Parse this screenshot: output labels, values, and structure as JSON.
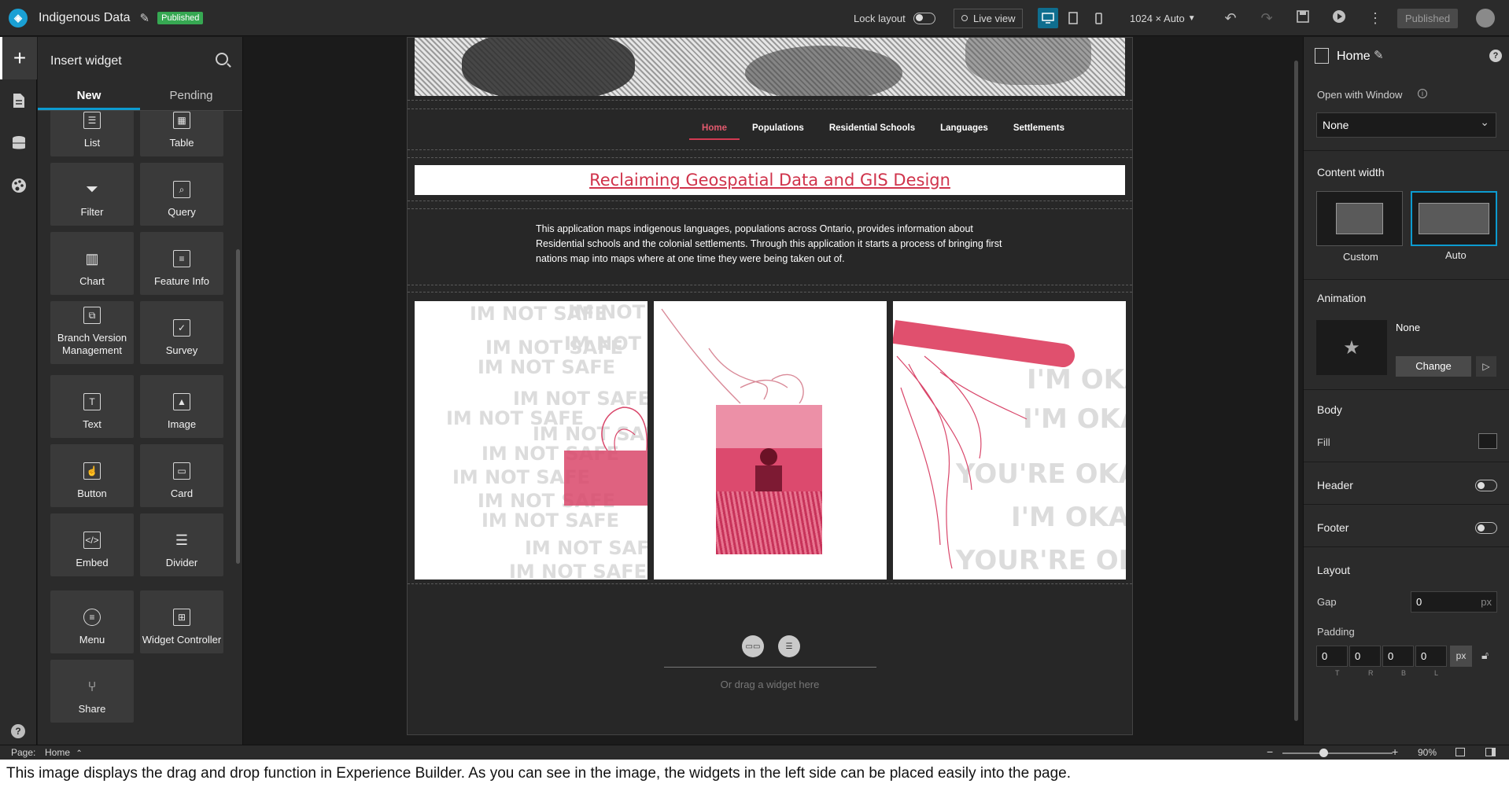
{
  "topbar": {
    "app_title": "Indigenous Data",
    "status_badge": "Published",
    "lock_layout_label": "Lock layout",
    "live_view_label": "Live view",
    "screen_size": "1024 × Auto",
    "publish_button": "Published"
  },
  "widget_panel": {
    "title": "Insert widget",
    "tabs": [
      "New",
      "Pending"
    ],
    "widgets": {
      "list": "List",
      "table": "Table",
      "filter": "Filter",
      "query": "Query",
      "chart": "Chart",
      "feature_info": "Feature Info",
      "branch_version": "Branch Version Management",
      "survey": "Survey",
      "text": "Text",
      "image": "Image",
      "button": "Button",
      "card": "Card",
      "embed": "Embed",
      "divider": "Divider",
      "menu": "Menu",
      "widget_controller": "Widget Controller",
      "share": "Share"
    }
  },
  "page": {
    "nav": [
      "Home",
      "Populations",
      "Residential Schools",
      "Languages",
      "Settlements"
    ],
    "title": "Reclaiming Geospatial Data and GIS Design",
    "description": "This application maps indigenous languages, populations across Ontario, provides information about Residential schools and the colonial settlements. Through this application it starts a process of bringing first nations map into maps where at one time they were being taken out of.",
    "card1_watermark": "IM NOT SAFE",
    "card3_watermark": [
      "I'M OKAY",
      "YOU'RE OKAY",
      "I'M OKAY",
      "YOUR'RE OKAY"
    ],
    "drop_hint": "Or drag a widget here"
  },
  "right_panel": {
    "page_name": "Home",
    "open_with_window_label": "Open with Window",
    "open_with_window_value": "None",
    "content_width_label": "Content width",
    "content_width_options": [
      "Custom",
      "Auto"
    ],
    "animation_label": "Animation",
    "animation_value": "None",
    "change_button": "Change",
    "body_label": "Body",
    "fill_label": "Fill",
    "header_label": "Header",
    "footer_label": "Footer",
    "layout_label": "Layout",
    "gap_label": "Gap",
    "gap_value": "0",
    "gap_unit": "px",
    "padding_label": "Padding",
    "padding_values": [
      "0",
      "0",
      "0",
      "0"
    ],
    "padding_sides": [
      "T",
      "R",
      "B",
      "L"
    ],
    "padding_unit": "px"
  },
  "statusbar": {
    "page_label": "Page:",
    "page_value": "Home",
    "zoom": "90%"
  },
  "caption": "This image displays the drag and drop function in Experience Builder.  As you can see in the image, the widgets in the left side can be placed easily into the page.",
  "colors": {
    "accent": "#0c9bd0",
    "brand_red": "#d0334b",
    "published_green": "#36a852"
  }
}
